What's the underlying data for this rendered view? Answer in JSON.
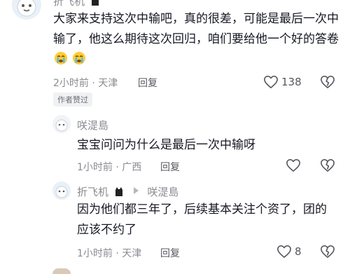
{
  "comments": [
    {
      "author": "折飞机",
      "text": "大家来支持这次中输吧，真的很差，可能是最后一次中输了，他这么期待这次回归，咱们要给他一个好的答卷",
      "emoji_count": 2,
      "time_location": "2小时前 · 天津",
      "reply_label": "回复",
      "likes": "138",
      "badge": "作者赞过"
    }
  ],
  "replies": [
    {
      "author": "咲湜島",
      "text": "宝宝问问为什么是最后一次中输呀",
      "time_location": "1小时前 · 广西",
      "reply_label": "回复",
      "likes": ""
    },
    {
      "author": "折飞机",
      "reply_to": "咲湜島",
      "text": "因为他们都三年了，后续基本关注个资了，团的应该不约了",
      "time_location": "1小时前 · 天津",
      "reply_label": "回复",
      "likes": "8"
    }
  ],
  "icons": {
    "like": "heart-outline-icon",
    "dislike": "broken-heart-icon",
    "cat": "black-cat-icon",
    "emoji": "crying-face-icon",
    "reply_arrow": "triangle-right-icon"
  },
  "colors": {
    "text": "#161823",
    "meta": "#8a8b91",
    "reply": "#57585e"
  }
}
